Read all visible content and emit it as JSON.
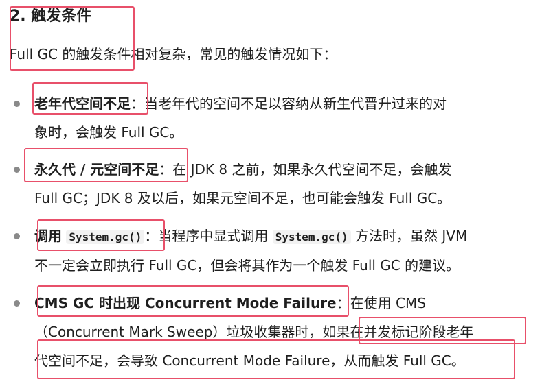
{
  "heading": "2. 触发条件",
  "intro": "Full GC 的触发条件相对复杂，常见的触发情况如下：",
  "items": [
    {
      "term": "老年代空间不足",
      "sep": "：",
      "line1": "当老年代的空间不足以容纳从新生代晋升过来的对",
      "line2": "象时，会触发 Full GC。"
    },
    {
      "term": "永久代 / 元空间不足",
      "sep": "：",
      "line1": "在 JDK 8 之前，如果永久代空间不足，会触发",
      "line2": "Full GC；JDK 8 及以后，如果元空间不足，也可能会触发 Full GC。"
    },
    {
      "term": "调用",
      "code": "System.gc()",
      "sep": "：",
      "line1a": "当程序中显式调用",
      "code2": "System.gc()",
      "line1b": "方法时，虽然 JVM",
      "line2": "不一定会立即执行 Full GC，但会将其作为一个触发 Full GC 的建议。"
    },
    {
      "term": "CMS GC 时出现 Concurrent Mode Failure",
      "sep": "：",
      "line1": "在使用 CMS",
      "line2": "（Concurrent Mark Sweep）垃圾收集器时，如果在并发标记阶段老年",
      "line3": "代空间不足，会导致 Concurrent Mode Failure，从而触发 Full GC。"
    }
  ],
  "colors": {
    "highlight_border": "#e8506a",
    "bullet": "#8a8a8a",
    "text": "#1f1f1f"
  }
}
